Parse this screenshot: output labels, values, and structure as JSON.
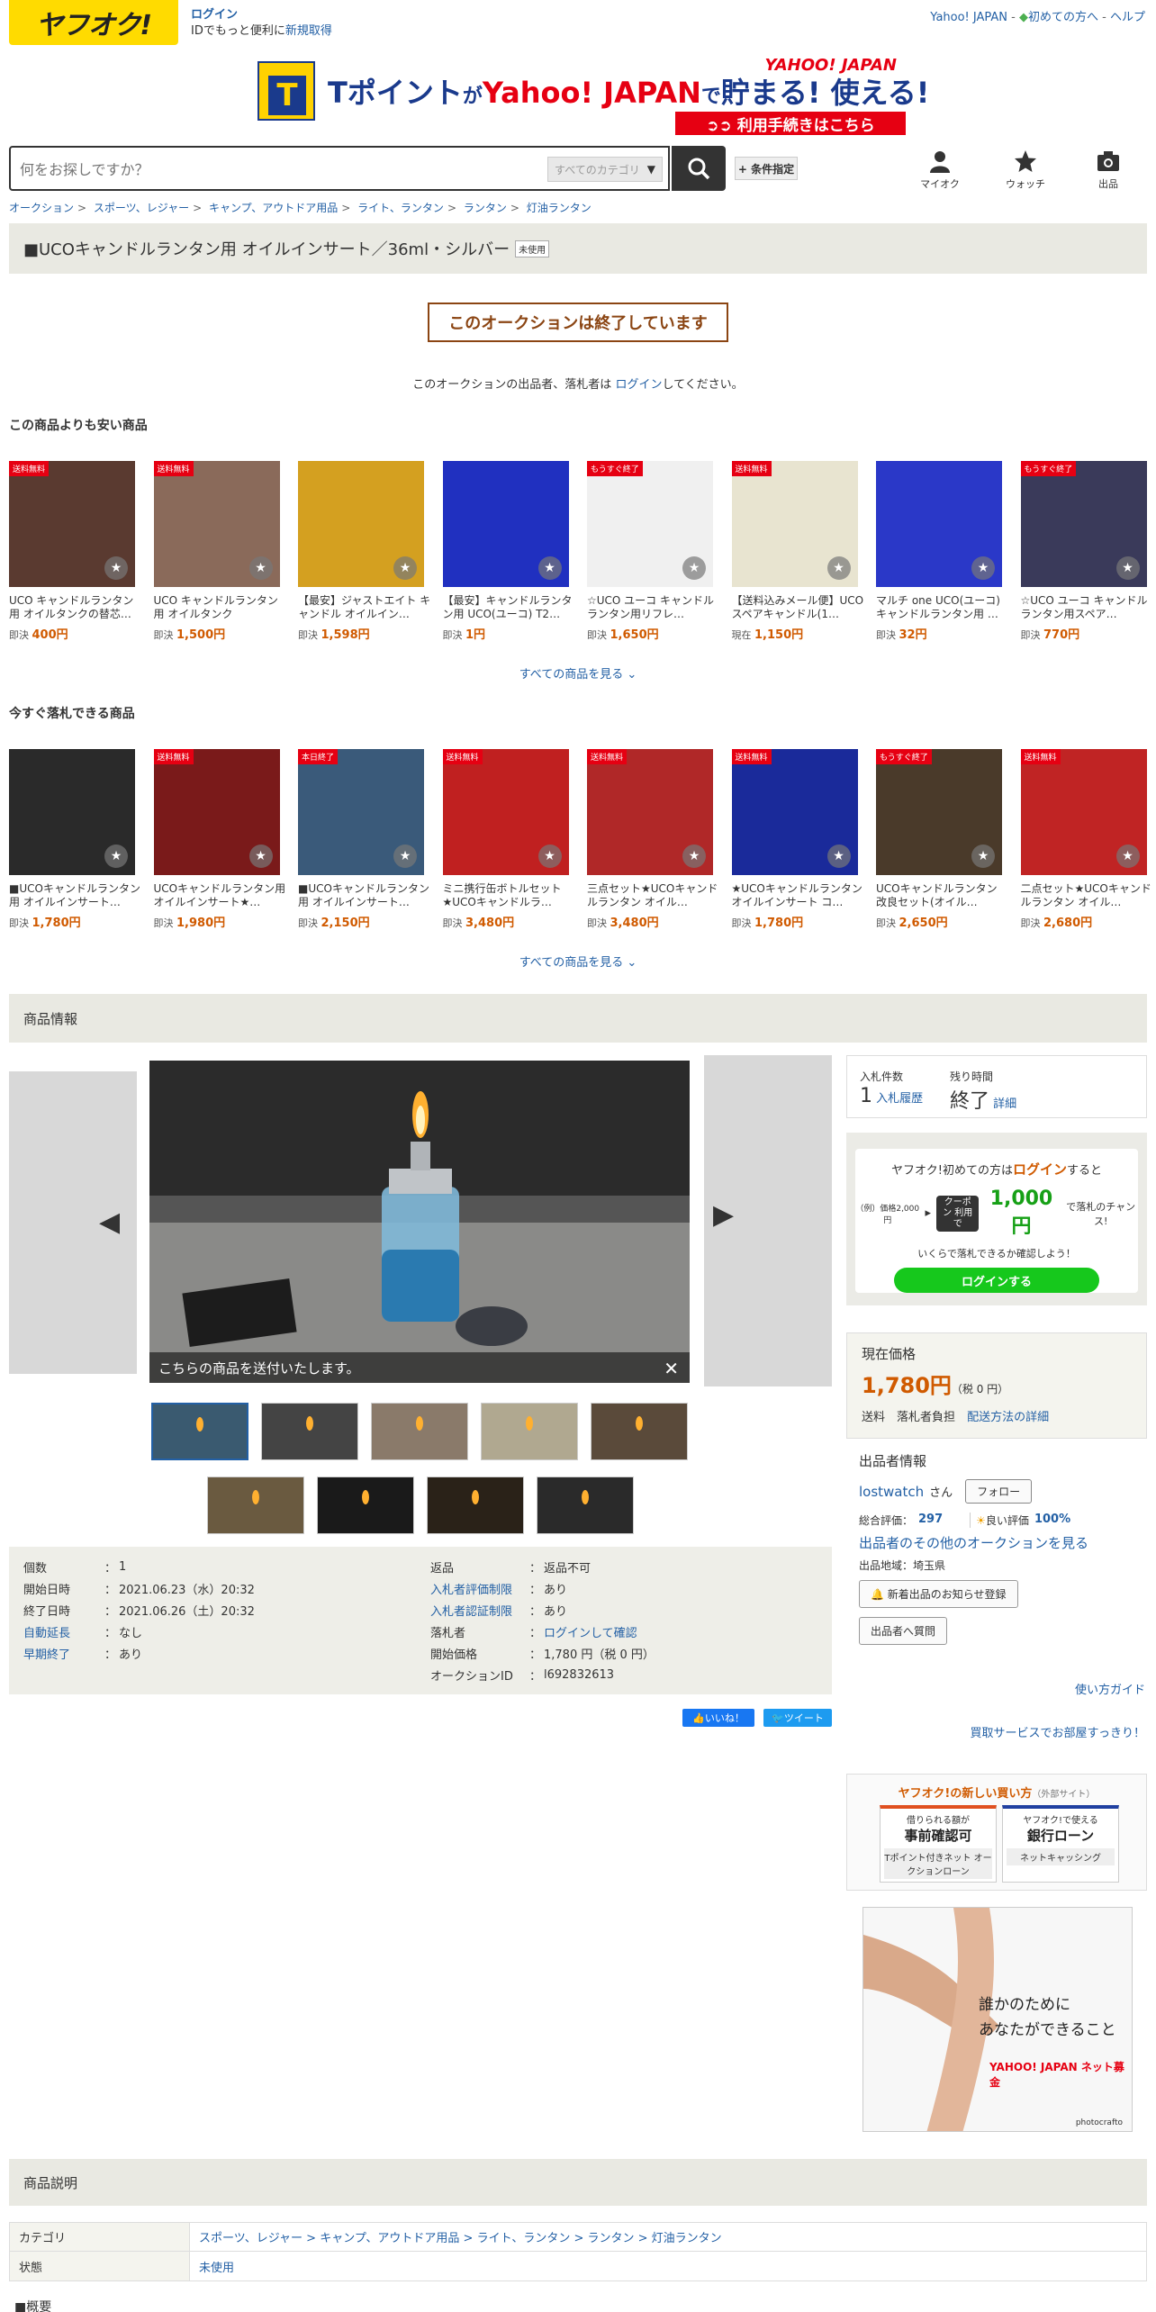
{
  "header": {
    "logo": "ヤフオク!",
    "login_link": "ログイン",
    "login_sub_prefix": "IDでもっと便利に",
    "register_link": "新規取得",
    "top_links": [
      "Yahoo! JAPAN",
      "初めての方へ",
      "ヘルプ"
    ],
    "search_placeholder": "何をお探しですか？",
    "category_select": "すべてのカテゴリ",
    "condition_button": "+ 条件指定",
    "nav": [
      {
        "label": "マイオク",
        "icon": "user-icon"
      },
      {
        "label": "ウォッチ",
        "icon": "star-icon"
      },
      {
        "label": "出品",
        "icon": "camera-icon"
      }
    ]
  },
  "banner": {
    "t_letter": "T",
    "text_part1": "Tポイント",
    "text_part2": "が",
    "text_part3": "Yahoo! JAPAN",
    "text_part4": "で",
    "text_part5": "貯まる! 使える!",
    "logo": "YAHOO! JAPAN",
    "button": "➲➲ 利用手続きはこちら"
  },
  "breadcrumb": [
    "オークション",
    "スポーツ、レジャー",
    "キャンプ、アウトドア用品",
    "ライト、ランタン",
    "ランタン",
    "灯油ランタン"
  ],
  "item_title": "■UCOキャンドルランタン用 オイルインサート／36ml・シルバー",
  "item_condition_badge": "未使用",
  "ended_notice": "このオークションは終了しています",
  "ended_msg_prefix": "このオークションの出品者、落札者は ",
  "ended_msg_link": "ログイン",
  "ended_msg_suffix": "してください。",
  "cheaper_section": {
    "heading": "この商品よりも安い商品",
    "items": [
      {
        "tag": "送料無料",
        "title": "UCO キャンドルランタン用 オイルタンクの替芯…",
        "price_label": "即決",
        "price": "400円",
        "bg": "#5a3a30"
      },
      {
        "tag": "送料無料",
        "title": "UCO キャンドルランタン用 オイルタンク",
        "price_label": "即決",
        "price": "1,500円",
        "bg": "#8a6a5a"
      },
      {
        "tag": "",
        "title": "【最安】ジャストエイト キャンドル オイルイン…",
        "price_label": "即決",
        "price": "1,598円",
        "bg": "#d4a020"
      },
      {
        "tag": "",
        "title": "【最安】キャンドルランタン用 UCO(ユーコ) T2…",
        "price_label": "即決",
        "price": "1円",
        "bg": "#2030c0"
      },
      {
        "tag": "もうすぐ終了",
        "title": "☆UCO ユーコ キャンドルランタン用リフレ…",
        "price_label": "即決",
        "price": "1,650円",
        "bg": "#f0f0f0"
      },
      {
        "tag": "送料無料",
        "title": "【送料込みメール便】UCO スペアキャンドル(1…",
        "price_label": "現在",
        "price": "1,150円",
        "bg": "#e8e4d0"
      },
      {
        "tag": "",
        "title": "マルチ one UCO(ユーコ)キャンドルランタン用 …",
        "price_label": "即決",
        "price": "32円",
        "bg": "#2a38c8"
      },
      {
        "tag": "もうすぐ終了",
        "title": "☆UCO ユーコ キャンドルランタン用スペア…",
        "price_label": "即決",
        "price": "770円",
        "bg": "#3a3a5a"
      }
    ]
  },
  "buynow_section": {
    "heading": "今すぐ落札できる商品",
    "items": [
      {
        "tag": "",
        "title": "■UCOキャンドルランタン用 オイルインサート…",
        "price_label": "即決",
        "price": "1,780円",
        "bg": "#2a2a2a"
      },
      {
        "tag": "送料無料",
        "title": "UCOキャンドルランタン用オイルインサート★…",
        "price_label": "即決",
        "price": "1,980円",
        "bg": "#7a1a1a"
      },
      {
        "tag": "本日終了",
        "title": "■UCOキャンドルランタン用 オイルインサート…",
        "price_label": "即決",
        "price": "2,150円",
        "bg": "#3a5a7a"
      },
      {
        "tag": "送料無料",
        "title": "ミニ携行缶ボトルセット★UCOキャンドルラ…",
        "price_label": "即決",
        "price": "3,480円",
        "bg": "#c02020"
      },
      {
        "tag": "送料無料",
        "title": "三点セット★UCOキャンドルランタン オイル…",
        "price_label": "即決",
        "price": "3,480円",
        "bg": "#b02828"
      },
      {
        "tag": "送料無料",
        "title": "★UCOキャンドルランタン オイルインサート コ…",
        "price_label": "即決",
        "price": "1,780円",
        "bg": "#1a2a9a"
      },
      {
        "tag": "もうすぐ終了",
        "title": "UCOキャンドルランタン 改良セット(オイル…",
        "price_label": "即決",
        "price": "2,650円",
        "bg": "#4a3a2a"
      },
      {
        "tag": "送料無料",
        "title": "二点セット★UCOキャンドルランタン オイル…",
        "price_label": "即決",
        "price": "2,680円",
        "bg": "#c02424"
      }
    ]
  },
  "see_all": "すべての商品を見る",
  "product_info_heading": "商品情報",
  "photo_caption": "こちらの商品を送付いたします。",
  "details_left": [
    {
      "key": "個数",
      "value": "1",
      "key_link": false
    },
    {
      "key": "開始日時",
      "value": "2021.06.23（水）20:32",
      "key_link": false
    },
    {
      "key": "終了日時",
      "value": "2021.06.26（土）20:32",
      "key_link": false
    },
    {
      "key": "自動延長",
      "value": "なし",
      "key_link": true
    },
    {
      "key": "早期終了",
      "value": "あり",
      "key_link": true
    }
  ],
  "details_right": [
    {
      "key": "返品",
      "value": "返品不可",
      "key_link": false,
      "value_link": false
    },
    {
      "key": "入札者評価制限",
      "value": "あり",
      "key_link": true,
      "value_link": false
    },
    {
      "key": "入札者認証制限",
      "value": "あり",
      "key_link": true,
      "value_link": false
    },
    {
      "key": "落札者",
      "value": "ログインして確認",
      "key_link": false,
      "value_link": true
    },
    {
      "key": "開始価格",
      "value": "1,780 円（税 0 円）",
      "key_link": false,
      "value_link": false
    },
    {
      "key": "オークションID",
      "value": "l692832613",
      "key_link": false,
      "value_link": false
    }
  ],
  "social": {
    "like": "いいね！",
    "tweet": "ツイート"
  },
  "bid_box": {
    "bids_label": "入札件数",
    "bids_count": "1",
    "bids_link": "入札履歴",
    "time_label": "残り時間",
    "time_value": "終了",
    "time_link": "詳細"
  },
  "coupon_box": {
    "line1_pre": "ヤフオク!初めての方は",
    "line1_link": "ログイン",
    "line1_post": "すると",
    "example": "（例）価格2,000円",
    "coupon_badge": "クーポン 利用で",
    "discount": "1,000円",
    "chance": "で落札のチャンス!",
    "note": "いくらで落札できるか確認しよう！",
    "button": "ログインする"
  },
  "price_box": {
    "label": "現在価格",
    "price": "1,780円",
    "tax": "（税 0 円）",
    "shipping_label": "送料",
    "shipping_value": "落札者負担",
    "shipping_link": "配送方法の詳細"
  },
  "seller_box": {
    "heading": "出品者情報",
    "seller_name": "lostwatch",
    "san": "さん",
    "follow": "フォロー",
    "rating_label": "総合評価：",
    "rating": "297",
    "good_label": "良い評価",
    "good_pct": "100%",
    "other_auctions": "出品者のその他のオークションを見る",
    "region": "出品地域：埼玉県",
    "notify_button": "新着出品のお知らせ登録",
    "question_button": "出品者へ質問"
  },
  "guide_link": "使い方ガイド",
  "cleanup_link": "買取サービスでお部屋すっきり！",
  "new_buy": {
    "heading": "ヤフオク!の新しい買い方",
    "external": "（外部サイト）",
    "card1_top": "借りられる額が",
    "card1_main": "事前確認可",
    "card1_sub": "Tポイント付きネット オークションローン",
    "card2_top": "ヤフオク!で使える",
    "card2_main": "銀行ローン",
    "card2_sub": "ネットキャッシング"
  },
  "ad": {
    "line1": "誰かのために",
    "line2": "あなたができること",
    "logo": "YAHOO! JAPAN ネット募金",
    "credit": "photocrafto"
  },
  "description_heading": "商品説明",
  "description_table": [
    {
      "key": "カテゴリ",
      "value": "スポーツ、レジャー > キャンプ、アウトドア用品 > ライト、ランタン > ランタン > 灯油ランタン"
    },
    {
      "key": "状態",
      "value": "未使用"
    }
  ],
  "overview_heading": "■概要",
  "colors": {
    "brand_yellow": "#ffdb00",
    "price_orange": "#d05a00",
    "link_blue": "#2360a5",
    "green_button": "#16c81c"
  }
}
